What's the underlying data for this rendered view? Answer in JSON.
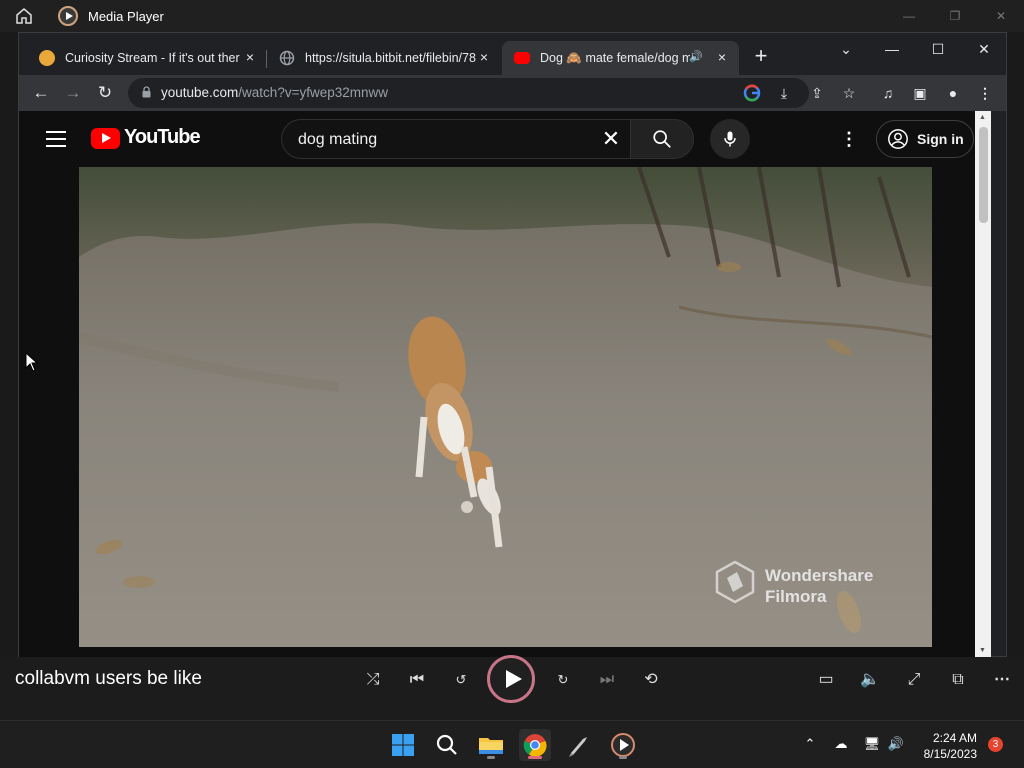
{
  "media_player": {
    "title": "Media Player",
    "now_playing": "collabvm users be like"
  },
  "browser": {
    "tabs": [
      {
        "label": "Curiosity Stream - If it's out there",
        "favicon_color": "#e8a93a"
      },
      {
        "label": "https://situla.bitbit.net/filebin/78",
        "favicon_color": "#9aa0a6"
      },
      {
        "label": "Dog 🙈 mate female/dog m",
        "favicon_color": "#ff0000"
      }
    ],
    "url_host": "youtube.com",
    "url_path": "/watch?v=yfwep32mnww"
  },
  "youtube": {
    "logo_text": "YouTube",
    "search_query": "dog mating",
    "signin_label": "Sign in",
    "watermark_line1": "Wondershare",
    "watermark_line2": "Filmora"
  },
  "taskbar": {
    "time": "2:24 AM",
    "date": "8/15/2023",
    "notification_count": "3"
  },
  "colors": {
    "youtube_red": "#ff0000",
    "play_ring": "#c8758a",
    "notification": "#e8432f"
  }
}
